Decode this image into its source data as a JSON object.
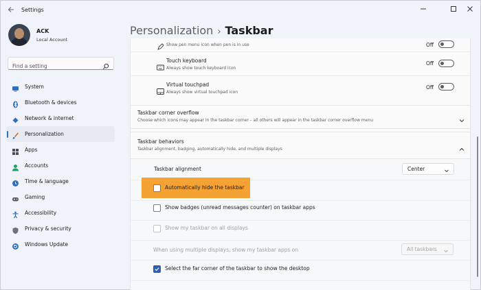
{
  "window": {
    "title": "Settings",
    "controls": [
      "minimize-icon",
      "maximize-icon",
      "close-icon"
    ]
  },
  "account": {
    "name": "ACK",
    "type": "Local Account"
  },
  "search": {
    "placeholder": "Find a setting"
  },
  "sidebar": {
    "items": [
      {
        "label": "System",
        "icon": "system-icon",
        "color": "#2f6fc0"
      },
      {
        "label": "Bluetooth & devices",
        "icon": "bluetooth-icon",
        "color": "#2f6fc0"
      },
      {
        "label": "Network & internet",
        "icon": "network-icon",
        "color": "#2f6fc0"
      },
      {
        "label": "Personalization",
        "icon": "paintbrush-icon",
        "color": "#d06a2a",
        "active": true
      },
      {
        "label": "Apps",
        "icon": "apps-icon",
        "color": "#4a4f5c"
      },
      {
        "label": "Accounts",
        "icon": "accounts-icon",
        "color": "#2a9a6a"
      },
      {
        "label": "Time & language",
        "icon": "globe-clock-icon",
        "color": "#2f6fc0"
      },
      {
        "label": "Gaming",
        "icon": "gaming-icon",
        "color": "#555b66"
      },
      {
        "label": "Accessibility",
        "icon": "accessibility-icon",
        "color": "#2f6fc0"
      },
      {
        "label": "Privacy & security",
        "icon": "shield-icon",
        "color": "#6b7280"
      },
      {
        "label": "Windows Update",
        "icon": "update-icon",
        "color": "#2f6fc0"
      }
    ]
  },
  "breadcrumb": {
    "parent": "Personalization",
    "separator": "›",
    "current": "Taskbar"
  },
  "pen_row": {
    "subtitle": "Show pen menu icon when pen is in use",
    "state": "Off"
  },
  "touch_keyboard": {
    "title": "Touch keyboard",
    "subtitle": "Always show touch keyboard icon",
    "state": "Off"
  },
  "virtual_touchpad": {
    "title": "Virtual touchpad",
    "subtitle": "Always show virtual touchpad icon",
    "state": "Off"
  },
  "corner_overflow": {
    "title": "Taskbar corner overflow",
    "subtitle": "Choose which icons may appear in the taskbar corner – all others will appear in the taskbar corner overflow menu"
  },
  "behaviors": {
    "title": "Taskbar behaviors",
    "subtitle": "Taskbar alignment, badging, automatically hide, and multiple displays",
    "alignment_label": "Taskbar alignment",
    "alignment_value": "Center",
    "auto_hide": "Automatically hide the taskbar",
    "badges": "Show badges (unread messages counter) on taskbar apps",
    "all_displays": "Show my taskbar on all displays",
    "multi_display_label": "When using multiple displays, show my taskbar apps on",
    "multi_display_value": "All taskbars",
    "far_corner": "Select the far corner of the taskbar to show the desktop",
    "far_corner_checked": true,
    "highlight_color": "#f4a233"
  },
  "colors": {
    "accent": "#2f5fb0"
  }
}
